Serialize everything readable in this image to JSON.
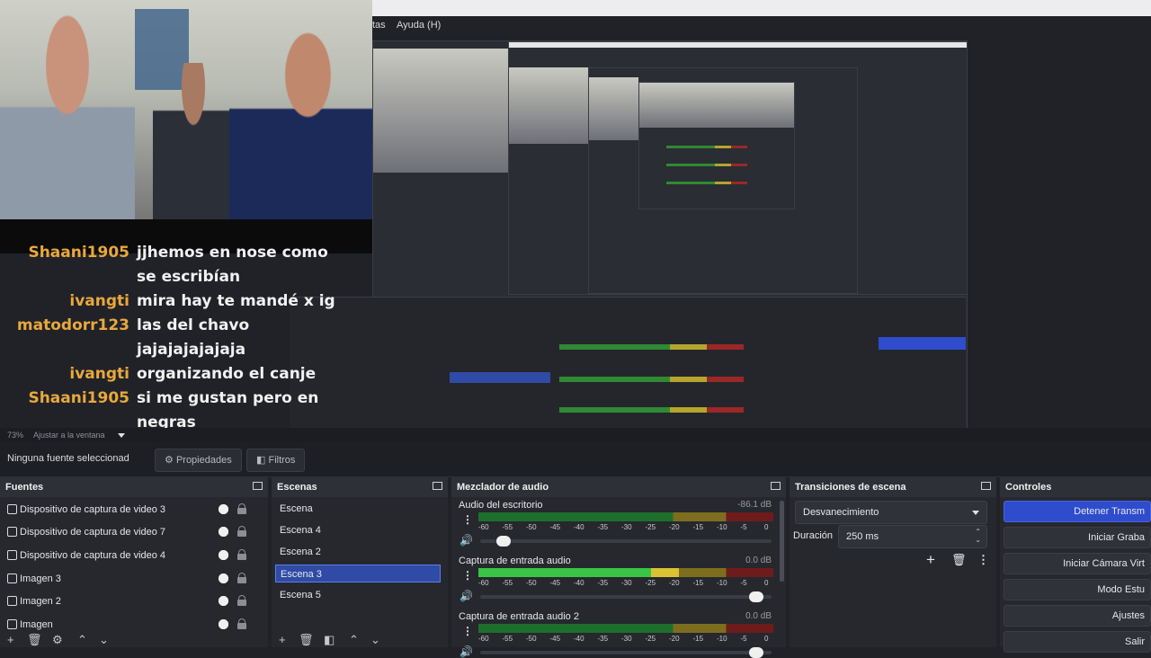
{
  "menu": {
    "item_partial": "tas",
    "help": "Ayuda (H)"
  },
  "chat": [
    {
      "name": "Shaani1905",
      "message": "jjhemos en nose como"
    },
    {
      "name": "",
      "message": "se escribían"
    },
    {
      "name": "ivangti",
      "message": "mira hay te mandé x ig"
    },
    {
      "name": "matodorr123",
      "message": "las del chavo"
    },
    {
      "name": "",
      "message": "jajajajajajaja"
    },
    {
      "name": "ivangti",
      "message": "organizando el canje"
    },
    {
      "name": "Shaani1905",
      "message": "si me gustan pero en"
    },
    {
      "name": "",
      "message": "negras"
    }
  ],
  "status": {
    "zoom": "73%",
    "fit": "Ajustar a la ventana"
  },
  "properties_bar": {
    "no_source": "Ninguna fuente seleccionad",
    "properties": "Propiedades",
    "filters": "Filtros"
  },
  "sources": {
    "title": "Fuentes",
    "items": [
      {
        "label": "Dispositivo de captura de video 3",
        "icon": "camera-icon"
      },
      {
        "label": "Dispositivo de captura de video 7",
        "icon": "camera-icon"
      },
      {
        "label": "Dispositivo de captura de video 4",
        "icon": "camera-icon"
      },
      {
        "label": "Imagen 3",
        "icon": "image-icon"
      },
      {
        "label": "Imagen 2",
        "icon": "image-icon"
      },
      {
        "label": "Imagen",
        "icon": "image-icon"
      }
    ]
  },
  "scenes": {
    "title": "Escenas",
    "items": [
      "Escena",
      "Escena 4",
      "Escena 2",
      "Escena 3",
      "Escena 5"
    ],
    "selected": "Escena 3"
  },
  "mixer": {
    "title": "Mezclador de audio",
    "ticks": [
      "-60",
      "-55",
      "-50",
      "-45",
      "-40",
      "-35",
      "-30",
      "-25",
      "-20",
      "-15",
      "-10",
      "-5",
      "0"
    ],
    "channels": [
      {
        "name": "Audio del escritorio",
        "db": "-86.1 dB",
        "level": 0.0,
        "volume": 0.06
      },
      {
        "name": "Captura de entrada audio",
        "db": "0.0 dB",
        "level": 0.68,
        "volume": 0.97
      },
      {
        "name": "Captura de entrada audio 2",
        "db": "0.0 dB",
        "level": 0.0,
        "volume": 0.97
      }
    ]
  },
  "transitions": {
    "title": "Transiciones de escena",
    "selected": "Desvanecimiento",
    "duration_label": "Duración",
    "duration": "250 ms"
  },
  "controls": {
    "title": "Controles",
    "buttons": [
      "Detener Transm",
      "Iniciar Graba",
      "Iniciar Cámara Virt",
      "Modo Estu",
      "Ajustes",
      "Salir"
    ]
  },
  "colors": {
    "accent": "#2f4ccd",
    "chat_name": "#e9a83b"
  }
}
